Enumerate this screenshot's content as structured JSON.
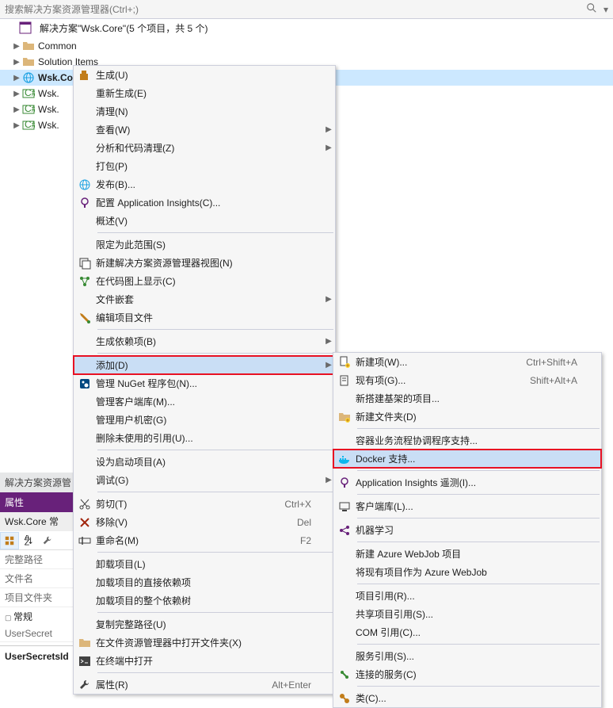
{
  "search": {
    "placeholder": "搜索解决方案资源管理器(Ctrl+;)"
  },
  "solution": {
    "title": "解决方案\"Wsk.Core\"(5 个项目，共 5 个)"
  },
  "tree": {
    "items": [
      {
        "label": "Common"
      },
      {
        "label": "Solution Items"
      },
      {
        "label": "Wsk.Core"
      },
      {
        "label": "Wsk."
      },
      {
        "label": "Wsk."
      },
      {
        "label": "Wsk."
      }
    ]
  },
  "panels": {
    "slnExplorer": "解决方案资源管",
    "props": "属性",
    "propsSubject": "Wsk.Core 常",
    "propRows": [
      "完整路径",
      "文件名",
      "项目文件夹"
    ],
    "propCategory": "常规",
    "propRow2": "UserSecret",
    "propBold": "UserSecretsId"
  },
  "menu1": [
    {
      "icon": "build",
      "label": "生成(U)"
    },
    {
      "label": "重新生成(E)"
    },
    {
      "label": "清理(N)"
    },
    {
      "label": "查看(W)",
      "sub": true
    },
    {
      "label": "分析和代码清理(Z)",
      "sub": true
    },
    {
      "label": "打包(P)"
    },
    {
      "icon": "publish",
      "label": "发布(B)..."
    },
    {
      "icon": "appinsights",
      "label": "配置 Application Insights(C)..."
    },
    {
      "label": "概述(V)"
    },
    {
      "sep": true
    },
    {
      "label": "限定为此范围(S)"
    },
    {
      "icon": "newview",
      "label": "新建解决方案资源管理器视图(N)"
    },
    {
      "icon": "codemap",
      "label": "在代码图上显示(C)"
    },
    {
      "label": "文件嵌套",
      "sub": true
    },
    {
      "icon": "edit",
      "label": "编辑项目文件"
    },
    {
      "sep": true
    },
    {
      "label": "生成依赖项(B)",
      "sub": true
    },
    {
      "sep": true
    },
    {
      "label": "添加(D)",
      "sub": true,
      "hl": true,
      "red": true
    },
    {
      "icon": "nuget",
      "label": "管理 NuGet 程序包(N)..."
    },
    {
      "label": "管理客户端库(M)..."
    },
    {
      "label": "管理用户机密(G)"
    },
    {
      "label": "删除未使用的引用(U)..."
    },
    {
      "sep": true
    },
    {
      "label": "设为启动项目(A)"
    },
    {
      "label": "调试(G)",
      "sub": true
    },
    {
      "sep": true
    },
    {
      "icon": "cut",
      "label": "剪切(T)",
      "short": "Ctrl+X"
    },
    {
      "icon": "remove",
      "label": "移除(V)",
      "short": "Del"
    },
    {
      "icon": "rename",
      "label": "重命名(M)",
      "short": "F2"
    },
    {
      "sep": true
    },
    {
      "label": "卸载项目(L)"
    },
    {
      "label": "加载项目的直接依赖项"
    },
    {
      "label": "加载项目的整个依赖树"
    },
    {
      "sep": true
    },
    {
      "label": "复制完整路径(U)"
    },
    {
      "icon": "openfolder",
      "label": "在文件资源管理器中打开文件夹(X)"
    },
    {
      "icon": "terminal",
      "label": "在终端中打开"
    },
    {
      "sep": true
    },
    {
      "icon": "props",
      "label": "属性(R)",
      "short": "Alt+Enter"
    }
  ],
  "menu2": [
    {
      "icon": "newitem",
      "label": "新建项(W)...",
      "short": "Ctrl+Shift+A"
    },
    {
      "icon": "existitem",
      "label": "现有项(G)...",
      "short": "Shift+Alt+A"
    },
    {
      "label": "新搭建基架的项目..."
    },
    {
      "icon": "newfolder",
      "label": "新建文件夹(D)"
    },
    {
      "sep": true
    },
    {
      "label": "容器业务流程协调程序支持..."
    },
    {
      "icon": "docker",
      "label": "Docker 支持...",
      "hl": true,
      "red": true
    },
    {
      "sep": true
    },
    {
      "icon": "appinsights",
      "label": "Application Insights 遥测(I)..."
    },
    {
      "sep": true
    },
    {
      "icon": "client",
      "label": "客户端库(L)..."
    },
    {
      "sep": true
    },
    {
      "icon": "ml",
      "label": "机器学习"
    },
    {
      "sep": true
    },
    {
      "label": "新建 Azure WebJob 项目"
    },
    {
      "label": "将现有项目作为 Azure WebJob"
    },
    {
      "sep": true
    },
    {
      "label": "项目引用(R)..."
    },
    {
      "label": "共享项目引用(S)..."
    },
    {
      "label": "COM 引用(C)..."
    },
    {
      "sep": true
    },
    {
      "label": "服务引用(S)..."
    },
    {
      "icon": "connected",
      "label": "连接的服务(C)"
    },
    {
      "sep": true
    },
    {
      "icon": "class",
      "label": "类(C)..."
    }
  ]
}
